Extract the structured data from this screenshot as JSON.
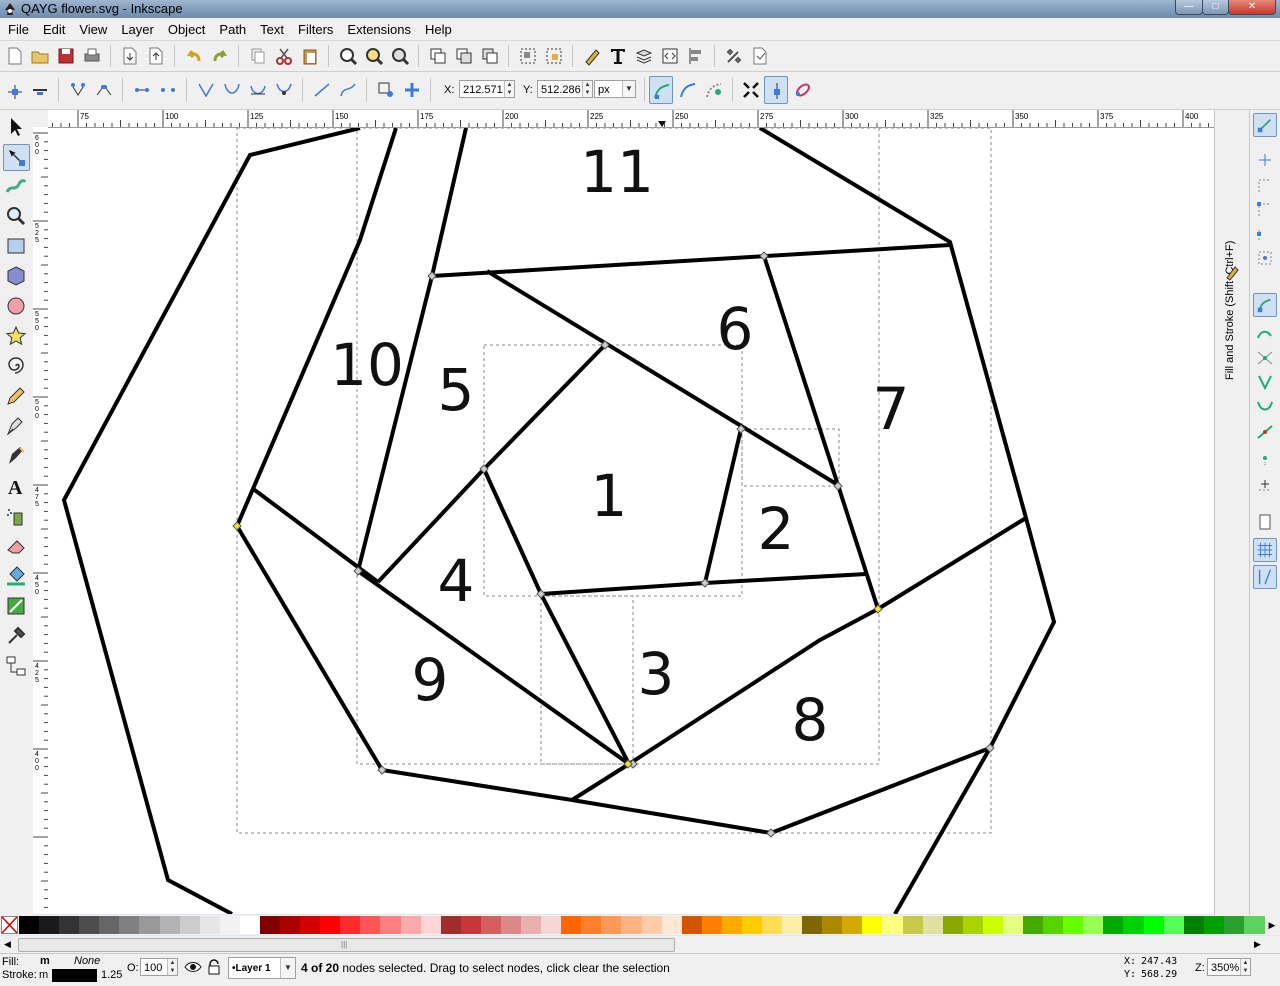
{
  "window": {
    "title": "QAYG flower.svg - Inkscape",
    "minimize": "—",
    "maximize": "□",
    "close": "✕"
  },
  "menu": [
    "File",
    "Edit",
    "View",
    "Layer",
    "Object",
    "Path",
    "Text",
    "Filters",
    "Extensions",
    "Help"
  ],
  "toolctrl": {
    "x_label": "X:",
    "x_value": "212.571",
    "y_label": "Y:",
    "y_value": "512.286",
    "unit": "px"
  },
  "ruler_h": [
    "75",
    "100",
    "125",
    "150",
    "175",
    "200",
    "225",
    "250",
    "275",
    "300",
    "325",
    "350",
    "375",
    "400"
  ],
  "ruler_v": [
    "6\n0\n0",
    "5\n2\n5",
    "5\n5\n0",
    "5\n0\n0",
    "4\n7\n5",
    "4\n5\n0",
    "4\n2\n5",
    "4\n0\n0"
  ],
  "canvas": {
    "labels": [
      "11",
      "10",
      "6",
      "5",
      "7",
      "1",
      "2",
      "4",
      "3",
      "9",
      "8"
    ]
  },
  "dock": {
    "panel_label": "Fill and Stroke (Shift+Ctrl+F)"
  },
  "palette": {
    "colors": [
      "#000000",
      "#1a1a1a",
      "#333333",
      "#4d4d4d",
      "#666666",
      "#808080",
      "#999999",
      "#b3b3b3",
      "#cccccc",
      "#e6e6e6",
      "#f2f2f2",
      "#ffffff",
      "#800000",
      "#aa0000",
      "#d40000",
      "#ff0000",
      "#ff2a2a",
      "#ff5555",
      "#ff8080",
      "#ffaaaa",
      "#ffd5d5",
      "#a02c2c",
      "#c83737",
      "#d35f5f",
      "#de8787",
      "#e9afaf",
      "#f4d7d7",
      "#ff6600",
      "#ff7f2a",
      "#ff9955",
      "#ffb380",
      "#ffccaa",
      "#ffe6d5",
      "#d45500",
      "#ff8000",
      "#ffaa00",
      "#ffcc00",
      "#ffdd55",
      "#ffeeaa",
      "#806600",
      "#aa8800",
      "#d4aa00",
      "#ffff00",
      "#ffff80",
      "#c8c84b",
      "#e0e0a0",
      "#88aa00",
      "#aad400",
      "#ccff00",
      "#e5ff80",
      "#44aa00",
      "#55d400",
      "#66ff00",
      "#99ff55",
      "#00aa00",
      "#00d400",
      "#00ff00",
      "#55ff55",
      "#008000",
      "#00a000",
      "#2ca02c",
      "#5fd35f"
    ]
  },
  "status": {
    "fill_label": "Fill:",
    "fill_value": "m",
    "fill_none": "None",
    "stroke_label": "Stroke:",
    "stroke_value": "m",
    "stroke_width": "1.25",
    "opacity_label": "O:",
    "opacity_value": "100",
    "layer": "•Layer 1",
    "message_bold": "4 of 20",
    "message": " nodes selected. Drag to select nodes, click clear the selection",
    "cursor_x_label": "X:",
    "cursor_x": "247.43",
    "cursor_y_label": "Y:",
    "cursor_y": "568.29",
    "zoom_label": "Z:",
    "zoom_value": "350%"
  }
}
